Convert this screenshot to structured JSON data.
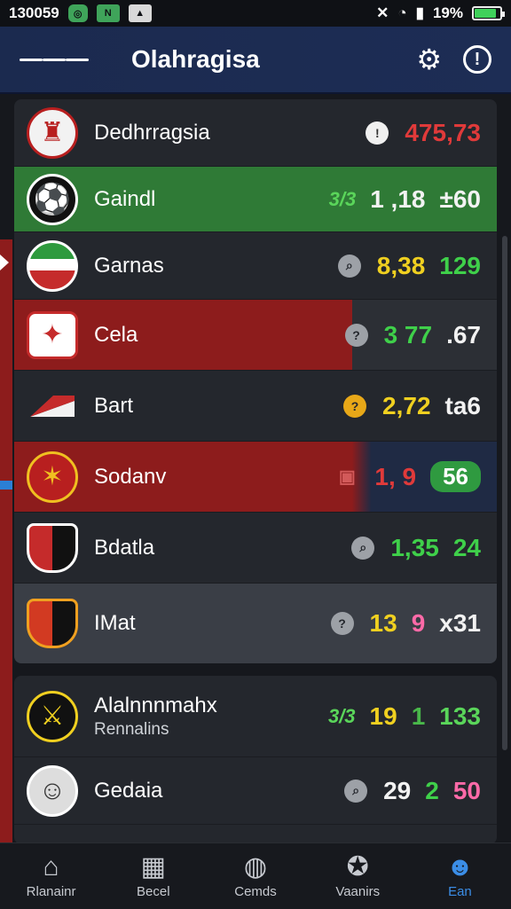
{
  "status_bar": {
    "time": "130059",
    "wifi_level": "19%",
    "badge1": "◎",
    "badge2": "N",
    "badge3": "▲"
  },
  "app_bar": {
    "title": "Olahragisa"
  },
  "rows": [
    {
      "name": "Dedhrragsia",
      "sub": "",
      "indicator": "!",
      "values": [
        "475,73"
      ]
    },
    {
      "name": "Gaindl",
      "sub": "",
      "values": [
        "3/3",
        "1 ,18",
        "±60"
      ]
    },
    {
      "name": "Garnas",
      "sub": "",
      "indicator": "⌕",
      "values": [
        "8,38",
        "129"
      ]
    },
    {
      "name": "Cela",
      "sub": "",
      "indicator": "?",
      "values": [
        "3 77",
        ".67"
      ]
    },
    {
      "name": "Bart",
      "sub": "",
      "indicator": "?",
      "values": [
        "2,72",
        "ta6"
      ]
    },
    {
      "name": "Sodanv",
      "sub": "",
      "values": [
        "1, 9",
        "56"
      ]
    },
    {
      "name": "Bdatla",
      "sub": "",
      "indicator": "⌕",
      "values": [
        "1,35",
        "24"
      ]
    },
    {
      "name": "IMat",
      "sub": "",
      "indicator": "?",
      "values": [
        "13",
        "9",
        "x31"
      ]
    },
    {
      "name": "Alalnnnmahx",
      "sub": "Rennalins",
      "values": [
        "3/3",
        "19",
        "1",
        "133"
      ]
    },
    {
      "name": "Gedaia",
      "sub": "",
      "indicator": "⌕",
      "values": [
        "29",
        "2",
        "50"
      ]
    }
  ],
  "bottom_nav": [
    {
      "label": "Rlanainr",
      "icon": "home-icon"
    },
    {
      "label": "Becel",
      "icon": "building-icon"
    },
    {
      "label": "Cemds",
      "icon": "ball-icon"
    },
    {
      "label": "Vaanirs",
      "icon": "star-icon"
    },
    {
      "label": "Ean",
      "icon": "profile-icon"
    }
  ]
}
